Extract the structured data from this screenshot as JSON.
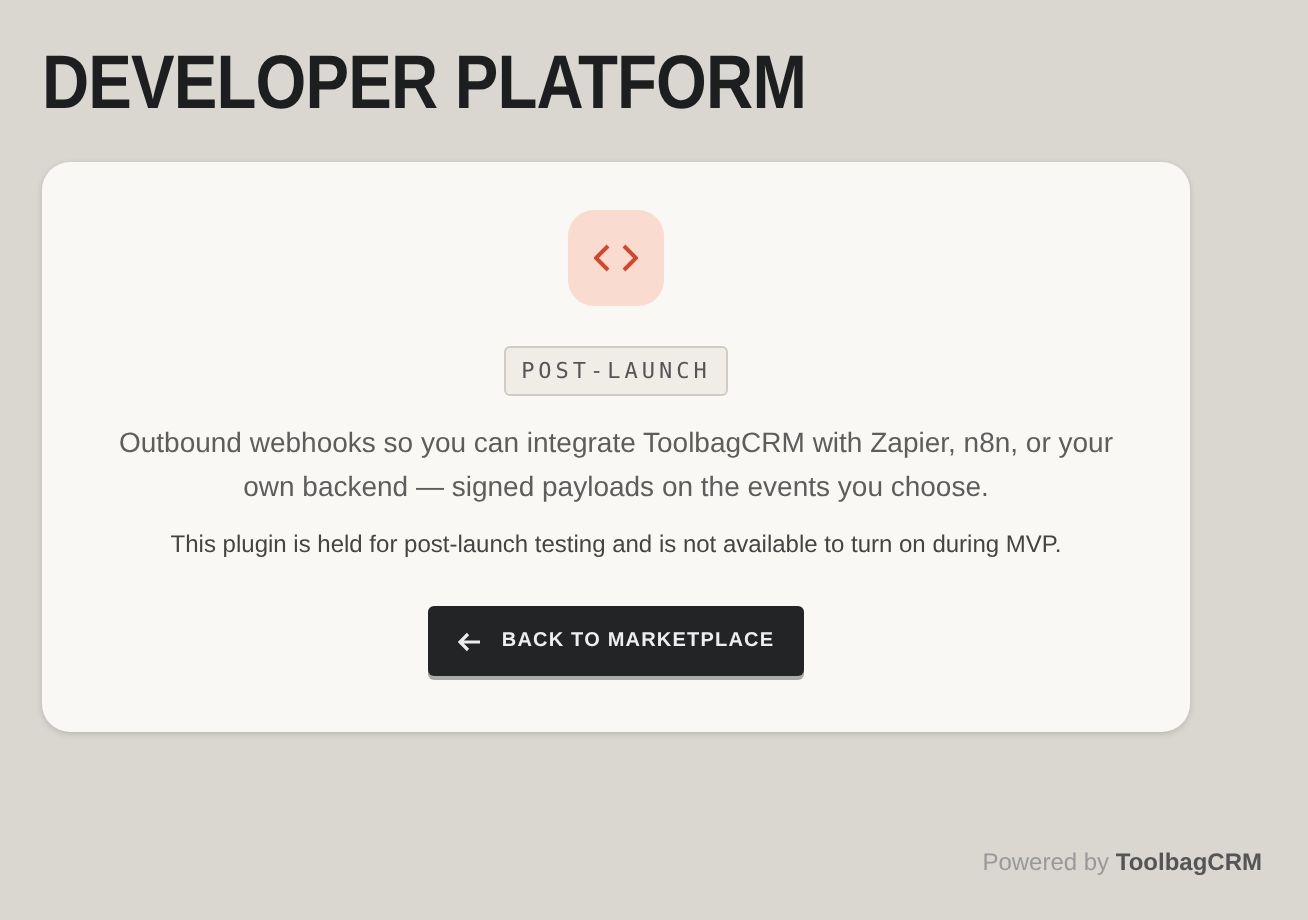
{
  "page": {
    "title": "DEVELOPER PLATFORM"
  },
  "card": {
    "badge": "POST-LAUNCH",
    "description": "Outbound webhooks so you can integrate ToolbagCRM with Zapier, n8n, or your own backend — signed payloads on the events you choose.",
    "note": "This plugin is held for post-launch testing and is not available to turn on during MVP.",
    "button": {
      "label": "BACK TO MARKETPLACE"
    }
  },
  "footer": {
    "text": "Powered by **ToolbagCRM**"
  }
}
